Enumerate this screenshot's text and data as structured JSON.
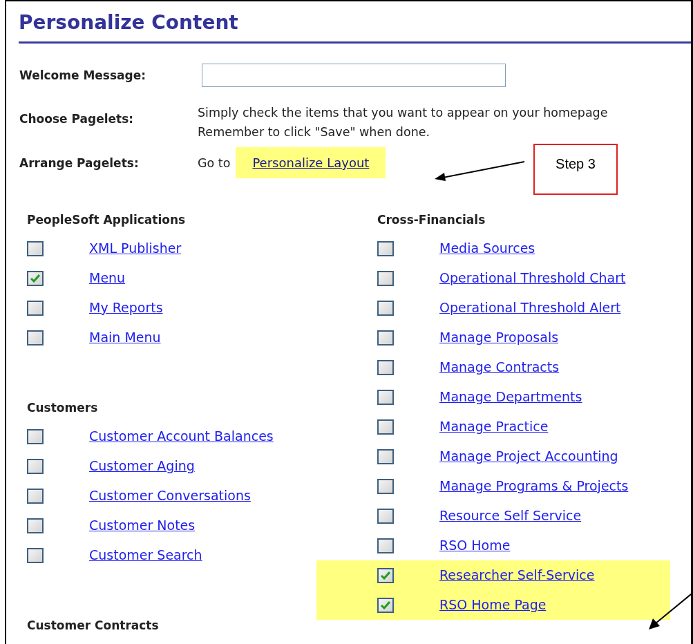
{
  "title": "Personalize Content",
  "form": [
    {
      "kind": "input",
      "label": "Welcome Message:"
    },
    {
      "kind": "text",
      "label": "Choose Pagelets:",
      "lines": [
        "Simply check the items that you want to appear on your homepage",
        "Remember to click \"Save\" when done."
      ]
    },
    {
      "kind": "link",
      "label": "Arrange Pagelets:",
      "prefix": "Go to",
      "link": "Personalize Layout",
      "highlighted": true
    }
  ],
  "columns": [
    {
      "groups": [
        {
          "title": "PeopleSoft Applications",
          "items": [
            {
              "label": "XML Publisher",
              "checked": false,
              "highlighted": false
            },
            {
              "label": "Menu",
              "checked": true,
              "highlighted": false
            },
            {
              "label": "My Reports",
              "checked": false,
              "highlighted": false
            },
            {
              "label": "Main Menu",
              "checked": false,
              "highlighted": false
            }
          ]
        },
        {
          "title": "Customers",
          "items": [
            {
              "label": "Customer Account Balances",
              "checked": false,
              "highlighted": false
            },
            {
              "label": "Customer Aging",
              "checked": false,
              "highlighted": false
            },
            {
              "label": "Customer Conversations",
              "checked": false,
              "highlighted": false
            },
            {
              "label": "Customer Notes",
              "checked": false,
              "highlighted": false
            },
            {
              "label": "Customer Search",
              "checked": false,
              "highlighted": false
            }
          ]
        },
        {
          "title": "Customer Contracts"
        }
      ]
    },
    {
      "groups": [
        {
          "title": "Cross-Financials",
          "items": [
            {
              "label": "Media Sources",
              "checked": false,
              "highlighted": false
            },
            {
              "label": "Operational Threshold Chart",
              "checked": false,
              "highlighted": false
            },
            {
              "label": "Operational Threshold Alert",
              "checked": false,
              "highlighted": false
            },
            {
              "label": "Manage Proposals",
              "checked": false,
              "highlighted": false
            },
            {
              "label": "Manage Contracts",
              "checked": false,
              "highlighted": false
            },
            {
              "label": "Manage Departments",
              "checked": false,
              "highlighted": false
            },
            {
              "label": "Manage Practice",
              "checked": false,
              "highlighted": false
            },
            {
              "label": "Manage Project Accounting",
              "checked": false,
              "highlighted": false
            },
            {
              "label": "Manage Programs & Projects",
              "checked": false,
              "highlighted": false
            },
            {
              "label": "Resource Self Service",
              "checked": false,
              "highlighted": false
            },
            {
              "label": "RSO Home",
              "checked": false,
              "highlighted": false
            },
            {
              "label": "Researcher Self-Service",
              "checked": true,
              "highlighted": true
            },
            {
              "label": "RSO Home Page",
              "checked": true,
              "highlighted": true
            }
          ]
        }
      ]
    }
  ],
  "callout": {
    "label": "Step 3"
  }
}
